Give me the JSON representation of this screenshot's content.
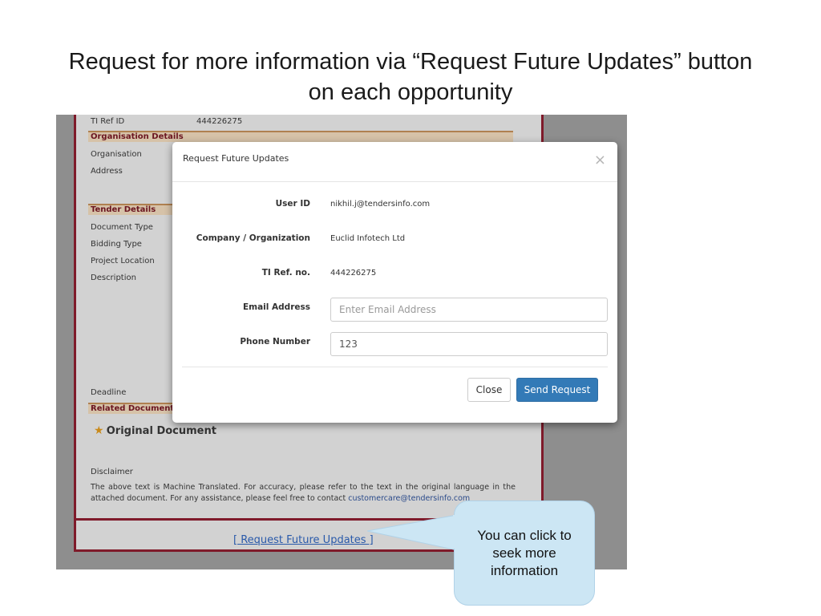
{
  "slide": {
    "title_line1": "Request for more information via “Request Future Updates” button",
    "title_line2": "on each opportunity"
  },
  "background_page": {
    "ti_ref_label": "TI Ref ID",
    "ti_ref_value": "444226275",
    "sections": {
      "organisation": "Organisation Details",
      "tender": "Tender Details",
      "related": "Related Documents"
    },
    "fields": {
      "organisation": "Organisation",
      "address": "Address",
      "document_type": "Document Type",
      "bidding_type": "Bidding Type",
      "project_location": "Project Location",
      "description": "Description",
      "deadline": "Deadline"
    },
    "original_document": "Original Document",
    "disclaimer_title": "Disclaimer",
    "disclaimer_text": "The above text is Machine Translated. For accuracy, please refer to the text in the original language in the attached document. For any assistance, please feel free to contact ",
    "disclaimer_email": "customercare@tendersinfo.com",
    "request_link": "[ Request Future Updates ]"
  },
  "modal": {
    "title": "Request Future Updates",
    "close_symbol": "×",
    "user_id_label": "User ID",
    "user_id_value": "nikhil.j@tendersinfo.com",
    "company_label": "Company / Organization",
    "company_value": "Euclid Infotech Ltd",
    "ti_ref_label": "TI Ref. no.",
    "ti_ref_value": "444226275",
    "email_label": "Email Address",
    "email_placeholder": "Enter Email Address",
    "phone_label": "Phone Number",
    "phone_value": "123",
    "close_button": "Close",
    "send_button": "Send Request"
  },
  "callout": {
    "text": "You can click to seek more information"
  },
  "colors": {
    "primary_button": "#337ab7",
    "page_border": "#7f1a2a",
    "callout_fill": "#cce6f4"
  },
  "icons": {
    "star": "star-icon",
    "close": "close-icon"
  }
}
